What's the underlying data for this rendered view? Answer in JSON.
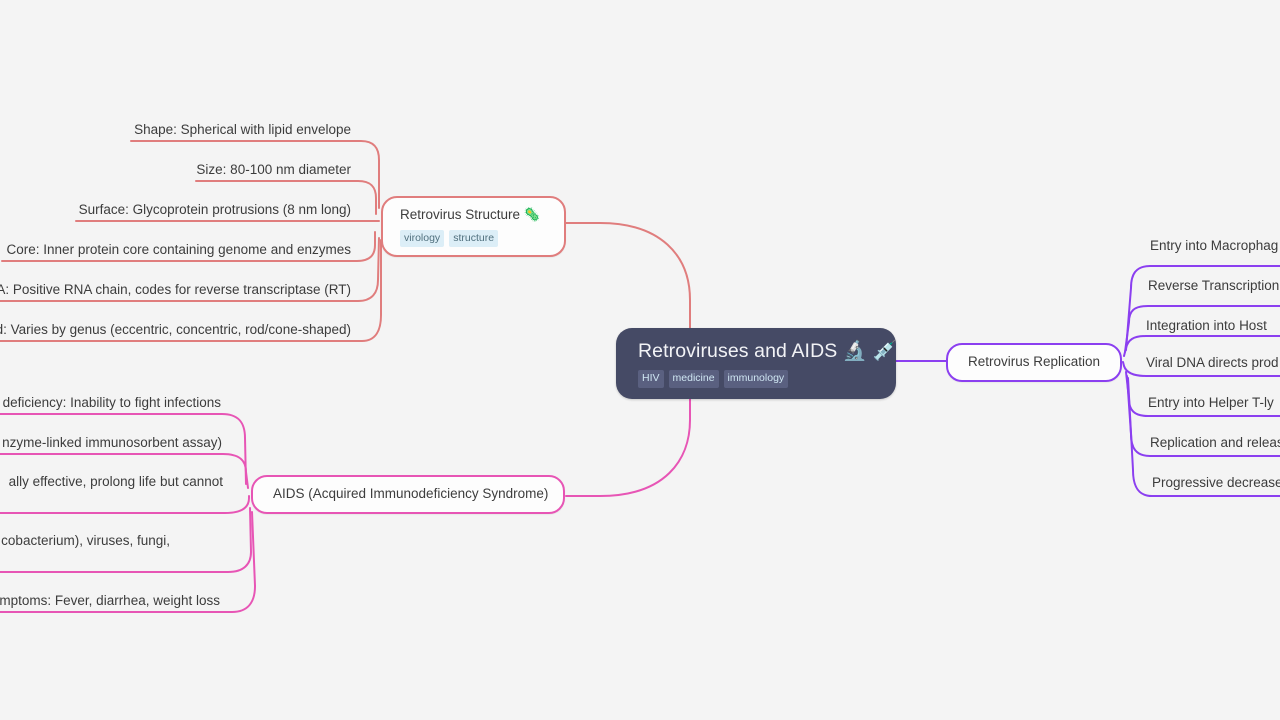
{
  "canvas": {
    "background": "#f4f4f4"
  },
  "center": {
    "title": "Retroviruses and AIDS 🔬 💉",
    "tags": [
      "HIV",
      "medicine",
      "immunology"
    ],
    "color": "#454a65"
  },
  "branches": [
    {
      "id": "structure",
      "title": "Retrovirus Structure 🦠",
      "tags": [
        "virology",
        "structure"
      ],
      "color": "#e07d7d",
      "items": [
        "Shape: Spherical with lipid envelope",
        "Size: 80-100 nm diameter",
        "Surface: Glycoprotein protrusions (8 nm long)",
        "Core: Inner protein core containing genome and enzymes",
        "NA: Positive RNA chain, codes for reverse transcriptase (RT)",
        "d: Varies by genus (eccentric, concentric, rod/cone-shaped)"
      ]
    },
    {
      "id": "replication",
      "title": "Retrovirus Replication",
      "tags": [],
      "color": "#8b3ff0",
      "items": [
        "Entry into Macrophag",
        "Reverse Transcription",
        "Integration into Host",
        "Viral DNA directs prod",
        "Entry into Helper T-ly",
        "Replication and releas",
        "Progressive decrease"
      ]
    },
    {
      "id": "aids",
      "title": "AIDS (Acquired Immunodeficiency Syndrome)",
      "tags": [],
      "color": "#e755b5",
      "items": [
        "deficiency: Inability to fight infections",
        "nzyme-linked immunosorbent assay)",
        "ally effective, prolong life but cannot",
        "cobacterium), viruses, fungi,",
        "mptoms: Fever, diarrhea, weight loss"
      ]
    }
  ]
}
